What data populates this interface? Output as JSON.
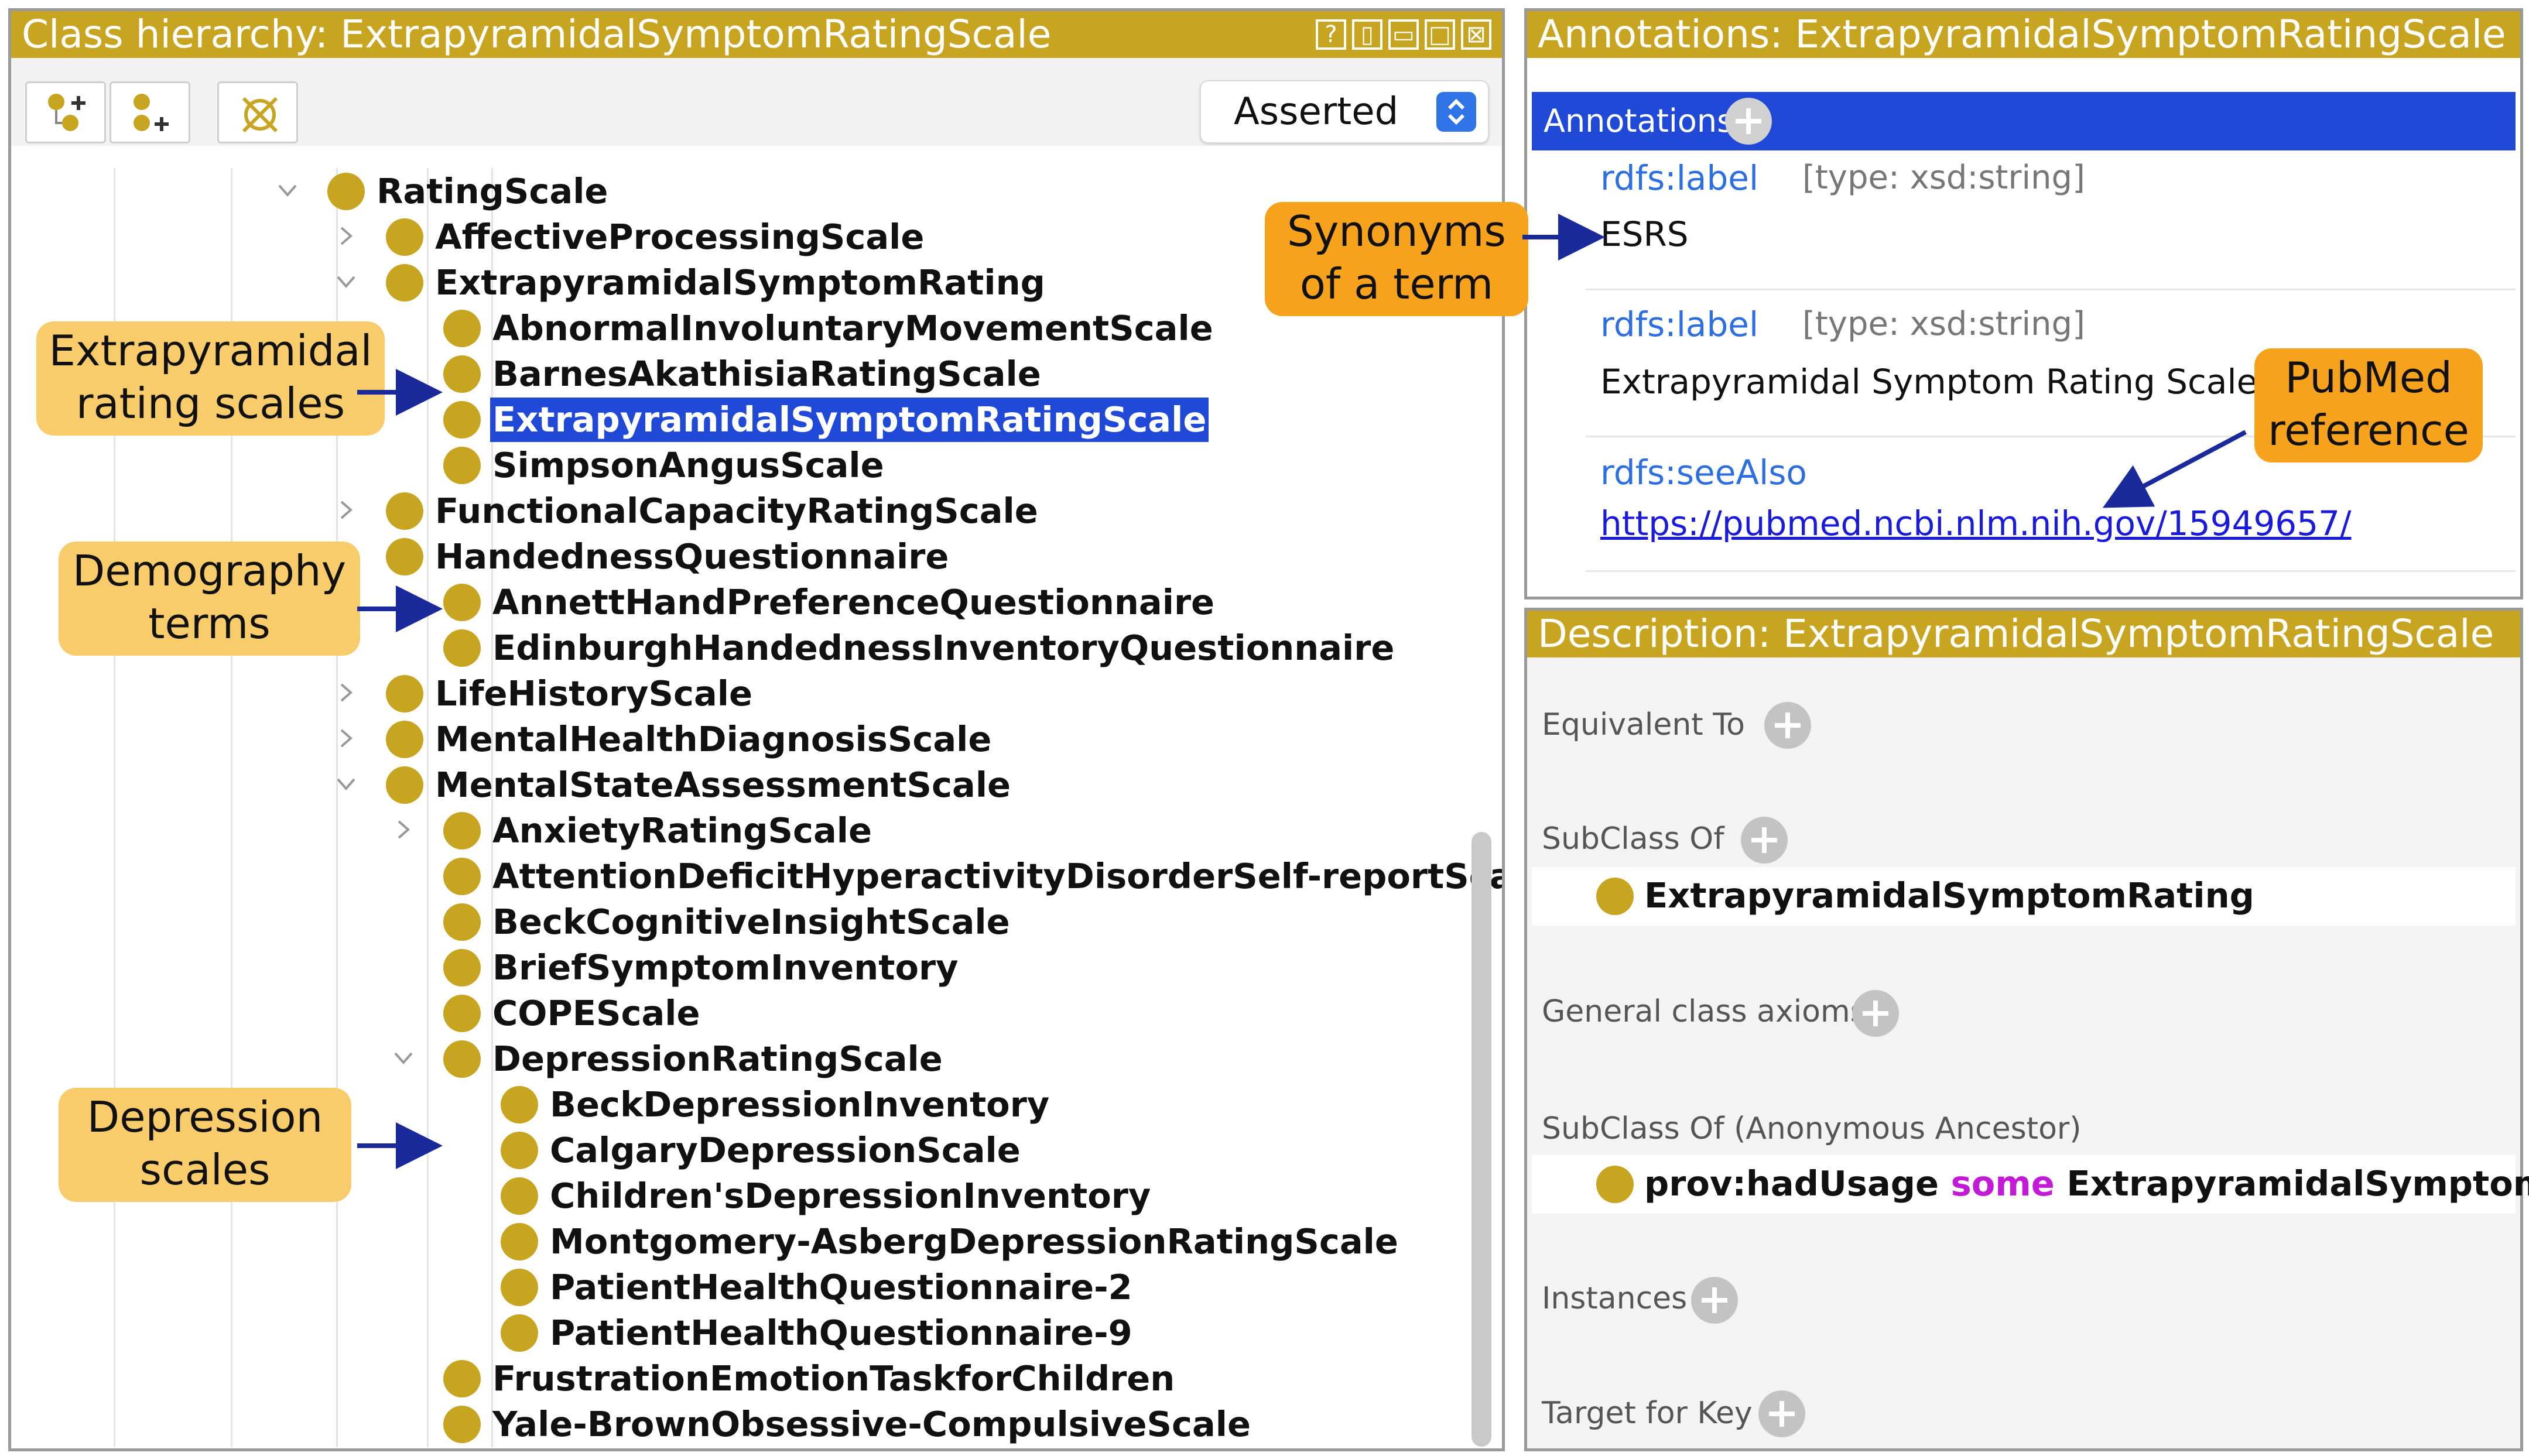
{
  "class_hierarchy": {
    "title": "Class hierarchy: ExtrapyramidalSymptomRatingScale",
    "header_controls": [
      "?",
      "▯",
      "▭",
      "□",
      "⊠"
    ],
    "mode_select": "Asserted",
    "tree": [
      {
        "label": "RatingScale",
        "state": "expanded"
      },
      {
        "label": "AffectiveProcessingScale",
        "state": "collapsed"
      },
      {
        "label": "ExtrapyramidalSymptomRating",
        "state": "expanded"
      },
      {
        "label": "AbnormalInvoluntaryMovementScale",
        "state": "leaf"
      },
      {
        "label": "BarnesAkathisiaRatingScale",
        "state": "leaf"
      },
      {
        "label": "ExtrapyramidalSymptomRatingScale",
        "state": "leaf",
        "selected": true
      },
      {
        "label": "SimpsonAngusScale",
        "state": "leaf"
      },
      {
        "label": "FunctionalCapacityRatingScale",
        "state": "collapsed"
      },
      {
        "label": "HandednessQuestionnaire",
        "state": "leaf"
      },
      {
        "label": "AnnettHandPreferenceQuestionnaire",
        "state": "leaf"
      },
      {
        "label": "EdinburghHandednessInventoryQuestionnaire",
        "state": "leaf"
      },
      {
        "label": "LifeHistoryScale",
        "state": "collapsed"
      },
      {
        "label": "MentalHealthDiagnosisScale",
        "state": "collapsed"
      },
      {
        "label": "MentalStateAssessmentScale",
        "state": "expanded"
      },
      {
        "label": "AnxietyRatingScale",
        "state": "collapsed"
      },
      {
        "label": "AttentionDeficitHyperactivityDisorderSelf-reportScale",
        "state": "leaf"
      },
      {
        "label": "BeckCognitiveInsightScale",
        "state": "leaf"
      },
      {
        "label": "BriefSymptomInventory",
        "state": "leaf"
      },
      {
        "label": "COPEScale",
        "state": "leaf"
      },
      {
        "label": "DepressionRatingScale",
        "state": "expanded"
      },
      {
        "label": "BeckDepressionInventory",
        "state": "leaf"
      },
      {
        "label": "CalgaryDepressionScale",
        "state": "leaf"
      },
      {
        "label": "Children'sDepressionInventory",
        "state": "leaf"
      },
      {
        "label": "Montgomery-AsbergDepressionRatingScale",
        "state": "leaf"
      },
      {
        "label": "PatientHealthQuestionnaire-2",
        "state": "leaf"
      },
      {
        "label": "PatientHealthQuestionnaire-9",
        "state": "leaf"
      },
      {
        "label": "FrustrationEmotionTaskforChildren",
        "state": "leaf"
      },
      {
        "label": "Yale-BrownObsessive-CompulsiveScale",
        "state": "leaf"
      }
    ]
  },
  "annotations": {
    "title": "Annotations: ExtrapyramidalSymptomRatingScale",
    "bar_label": "Annotations",
    "items": [
      {
        "property": "rdfs:label",
        "type": "[type: xsd:string]",
        "value": "ESRS"
      },
      {
        "property": "rdfs:label",
        "type": "[type: xsd:string]",
        "value": "Extrapyramidal Symptom Rating Scale"
      },
      {
        "property": "rdfs:seeAlso",
        "value": "https://pubmed.ncbi.nlm.nih.gov/15949657/"
      }
    ]
  },
  "description": {
    "title": "Description: ExtrapyramidalSymptomRatingScale",
    "sections": [
      {
        "label": "Equivalent To"
      },
      {
        "label": "SubClass Of",
        "entry": "ExtrapyramidalSymptomRating"
      },
      {
        "label": "General class axioms"
      },
      {
        "label": "SubClass Of (Anonymous Ancestor)",
        "entry_parts": [
          "prov:hadUsage",
          "some",
          "ExtrapyramidalSymptom"
        ]
      },
      {
        "label": "Instances"
      },
      {
        "label": "Target for Key"
      }
    ]
  },
  "callouts": {
    "extrapyramidal": "Extrapyramidal\nrating scales",
    "demography": "Demography\nterms",
    "depression": "Depression\nscales",
    "synonyms": "Synonyms\nof a term",
    "pubmed": "PubMed\nreference"
  },
  "colors": {
    "header": "#c8a521",
    "selection": "#1f49d6",
    "class_dot": "#c8a521",
    "callout_yellow": "#f8cc6a",
    "callout_orange": "#f7a21c",
    "arrow": "#1a2a9a",
    "keyword": "#c21ad6"
  }
}
